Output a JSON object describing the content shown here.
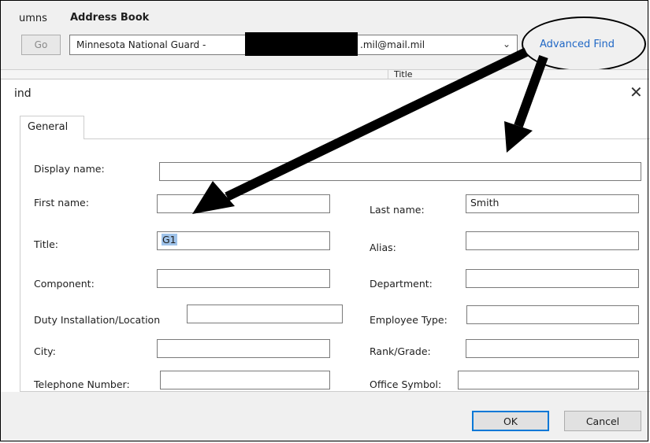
{
  "address_book": {
    "columns_label": "umns",
    "title": "Address Book",
    "go_label": "Go",
    "selected_prefix": "Minnesota National Guard -",
    "selected_suffix": ".mil@mail.mil",
    "advanced_find": "Advanced Find",
    "title_column": "Title"
  },
  "dialog": {
    "title": "ind",
    "tab_general": "General",
    "fields": {
      "display_name": {
        "label": "Display name:",
        "value": ""
      },
      "first_name": {
        "label": "First name:",
        "value": ""
      },
      "last_name": {
        "label": "Last name:",
        "value": "Smith"
      },
      "title": {
        "label": "Title:",
        "value": "G1"
      },
      "alias": {
        "label": "Alias:",
        "value": ""
      },
      "component": {
        "label": "Component:",
        "value": ""
      },
      "department": {
        "label": "Department:",
        "value": ""
      },
      "duty_installation": {
        "label": "Duty Installation/Location",
        "value": ""
      },
      "employee_type": {
        "label": "Employee Type:",
        "value": ""
      },
      "city": {
        "label": "City:",
        "value": ""
      },
      "rank_grade": {
        "label": "Rank/Grade:",
        "value": ""
      },
      "telephone_number": {
        "label": "Telephone Number:",
        "value": ""
      },
      "office_symbol": {
        "label": "Office Symbol:",
        "value": ""
      }
    },
    "ok": "OK",
    "cancel": "Cancel"
  },
  "icons": {
    "close": "close-icon",
    "dropdown": "chevron-down-icon"
  },
  "colors": {
    "link": "#1f67c5",
    "selection": "#9fc3ea",
    "primary_border": "#0078d7",
    "annotation": "#000000"
  }
}
